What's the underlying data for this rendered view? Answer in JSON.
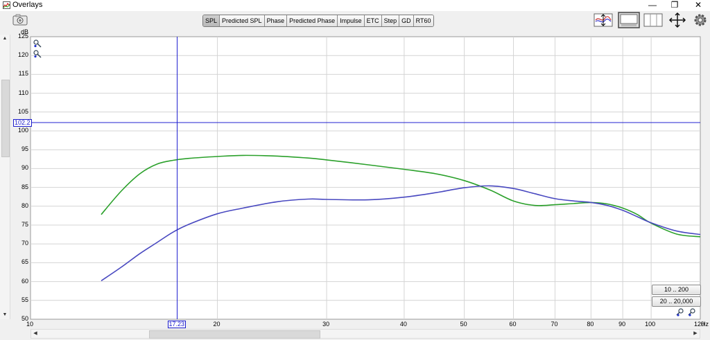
{
  "window": {
    "title": "Overlays",
    "minimize_glyph": "—",
    "restore_glyph": "❐",
    "close_glyph": "✕"
  },
  "tabs": [
    {
      "label": "SPL",
      "active": true
    },
    {
      "label": "Predicted SPL",
      "active": false
    },
    {
      "label": "Phase",
      "active": false
    },
    {
      "label": "Predicted Phase",
      "active": false
    },
    {
      "label": "Impulse",
      "active": false
    },
    {
      "label": "ETC",
      "active": false
    },
    {
      "label": "Step",
      "active": false
    },
    {
      "label": "GD",
      "active": false
    },
    {
      "label": "RT60",
      "active": false
    }
  ],
  "toolbar_icons": [
    "limits-icon",
    "controls-icon",
    "layout-icon",
    "pan-icon",
    "settings-gear-icon"
  ],
  "axes": {
    "y_unit": "dB",
    "x_unit": "Hz",
    "y_ticks": [
      "125",
      "120",
      "115",
      "110",
      "105",
      "100",
      "95",
      "90",
      "85",
      "80",
      "75",
      "70",
      "65",
      "60",
      "55",
      "50"
    ],
    "x_ticks": [
      "10",
      "20",
      "30",
      "40",
      "50",
      "60",
      "70",
      "80",
      "90",
      "100",
      "120"
    ]
  },
  "cursor": {
    "x_value": "17.23",
    "y_value": "102.2"
  },
  "range_buttons": [
    "10 .. 200",
    "20 .. 20,000"
  ],
  "chart_data": {
    "type": "line",
    "x_scale": "log",
    "xlim": [
      10,
      120
    ],
    "ylim": [
      50,
      125
    ],
    "xlabel": "Hz",
    "ylabel": "dB",
    "grid": true,
    "cursor": {
      "x": 17.23,
      "y": 102.2
    },
    "series": [
      {
        "color": "#2aa02a",
        "x": [
          13,
          14,
          15,
          16,
          17,
          18,
          20,
          22,
          25,
          28,
          30,
          35,
          40,
          45,
          50,
          55,
          60,
          65,
          70,
          75,
          80,
          85,
          90,
          95,
          100,
          110,
          120
        ],
        "y": [
          77.8,
          84,
          88.6,
          91.2,
          92.2,
          92.7,
          93.2,
          93.5,
          93.3,
          92.8,
          92.3,
          91,
          89.8,
          88.6,
          86.8,
          84.3,
          81.4,
          80.2,
          80.4,
          80.7,
          81,
          80.6,
          79.5,
          77.8,
          75.5,
          72.6,
          71.9
        ]
      },
      {
        "color": "#4848c0",
        "x": [
          13,
          14,
          15,
          16,
          17,
          18,
          20,
          22,
          25,
          28,
          30,
          35,
          40,
          45,
          50,
          55,
          60,
          65,
          70,
          75,
          80,
          85,
          90,
          95,
          100,
          110,
          120
        ],
        "y": [
          60.2,
          63.8,
          67.4,
          70.4,
          73.2,
          75.2,
          78,
          79.5,
          81.2,
          81.9,
          81.8,
          81.7,
          82.4,
          83.6,
          84.9,
          85.4,
          84.7,
          83.3,
          82,
          81.4,
          81,
          80.2,
          78.9,
          77.2,
          75.6,
          73.4,
          72.5
        ]
      }
    ]
  }
}
